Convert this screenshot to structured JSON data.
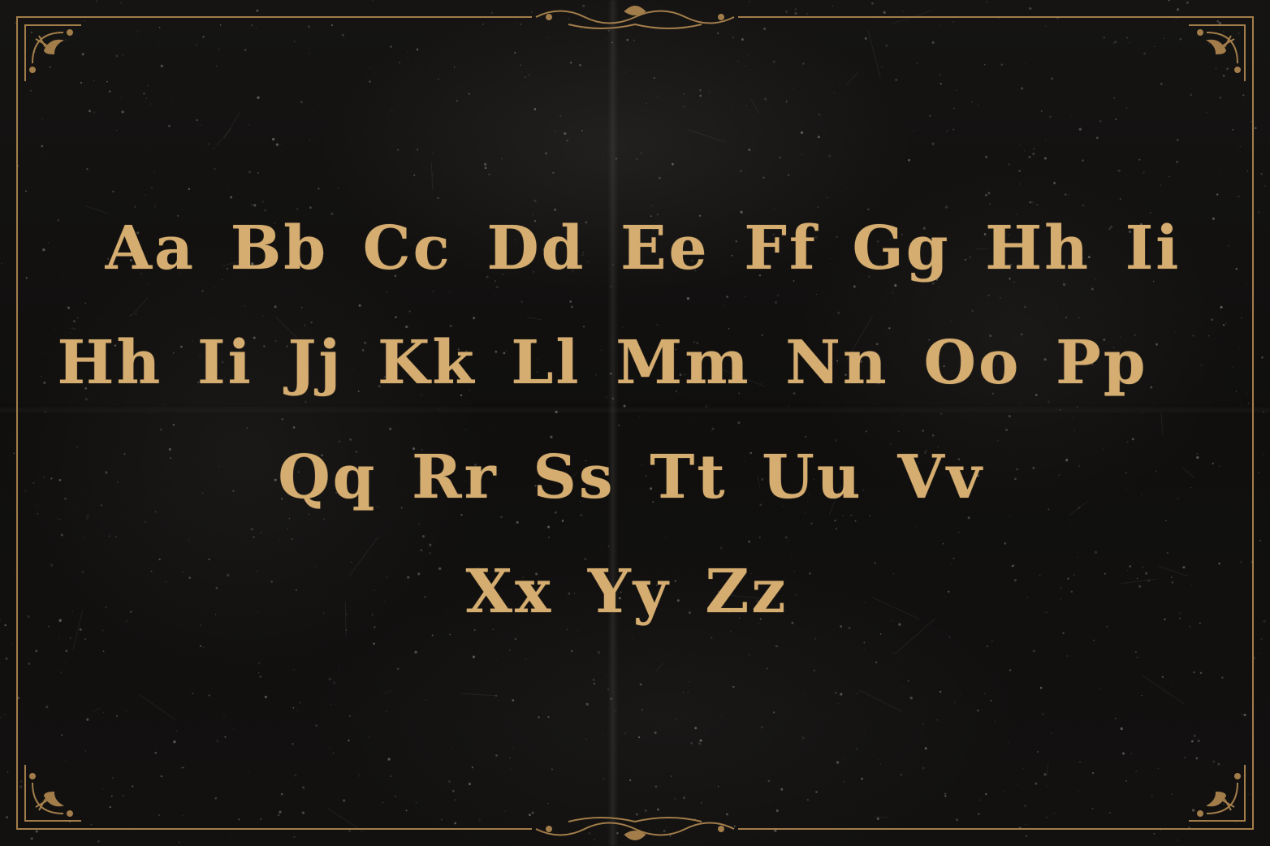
{
  "colors": {
    "background": "#111010",
    "gold": "#d5ad70",
    "frame": "#a27d4a"
  },
  "alphabet": {
    "lines": [
      "Aa Bb Cc Dd Ee Ff Gg Hh Ii",
      "Hh Ii Jj Kk Ll Mm Nn Oo Pp",
      "Qq Rr Ss Tt Uu Vv",
      "Xx Yy Zz"
    ]
  }
}
